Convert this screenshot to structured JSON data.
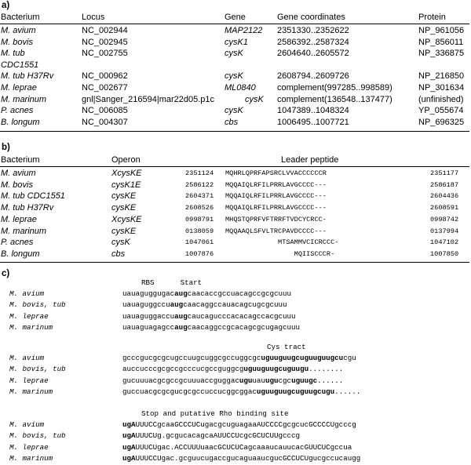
{
  "section_a": {
    "label": "a)",
    "headers": [
      "Bacterium",
      "Locus",
      "Gene",
      "Gene coordinates",
      "Protein"
    ],
    "rows": [
      {
        "bacterium": "M. avium",
        "locus": "NC_002944",
        "gene": "MAP2122",
        "coords": "2351330..2352622",
        "protein": "NP_961056"
      },
      {
        "bacterium": "M. bovis",
        "locus": "NC_002945",
        "gene": "cysK1",
        "coords": "2586392..2587324",
        "protein": "NP_856011"
      },
      {
        "bacterium": "M. tub",
        "locus": "NC_002755",
        "gene": "cysK",
        "coords": "2604640..2605572",
        "protein": "NP_336875"
      },
      {
        "bacterium": "CDC1551",
        "locus": "",
        "gene": "",
        "coords": "",
        "protein": ""
      },
      {
        "bacterium": "M. tub H37Rv",
        "locus": "NC_000962",
        "gene": "cysK",
        "coords": "2608794..2609726",
        "protein": "NP_216850"
      },
      {
        "bacterium": "M. leprae",
        "locus": "NC_002677",
        "gene": "ML0840",
        "coords": "complement(997285..998589)",
        "protein": "NP_301634"
      },
      {
        "bacterium": "M. marinum",
        "locus": "gnl|Sanger_216594|mar22d05.p1c",
        "gene": "cysK",
        "coords": "complement(136548..137477)",
        "protein": "(unfinished)"
      },
      {
        "bacterium": "P. acnes",
        "locus": "NC_006085",
        "gene": "cysK",
        "coords": "1047389..1048324",
        "protein": "YP_055674"
      },
      {
        "bacterium": "B. longum",
        "locus": "NC_004307",
        "gene": "cbs",
        "coords": "1006495..1007721",
        "protein": "NP_696325"
      }
    ]
  },
  "section_b": {
    "label": "b)",
    "headers": [
      "Bacterium",
      "Operon",
      "Leader peptide"
    ],
    "rows": [
      {
        "bacterium": "M. avium",
        "operon": "XcysKE",
        "start": "2351124",
        "peptide": "MQHRLQPRFAPSRCLVVACCCCCCR",
        "end": "2351177"
      },
      {
        "bacterium": "M. bovis",
        "operon": "cysK1E",
        "start": "2586122",
        "peptide": "MQQAIQLRFILPRRLAVGCCCC---",
        "end": "2586187"
      },
      {
        "bacterium": "M. tub CDC1551",
        "operon": "cysKE",
        "start": "2604371",
        "peptide": "MQQAIQLRFILPRRLAVGCCCC---",
        "end": "2604436"
      },
      {
        "bacterium": "M. tub H37Rv",
        "operon": "cysKE",
        "start": "2608526",
        "peptide": "MQQAIQLRFILPRRLAVGCCCC---",
        "end": "2608591"
      },
      {
        "bacterium": "M. leprae",
        "operon": "XcysKE",
        "start": "0998791",
        "peptide": "MHQSTQPRFVFTRRFTVDCYCRCC-",
        "end": "0998742"
      },
      {
        "bacterium": "M. marinum",
        "operon": "cysKE",
        "start": "0138059",
        "peptide": "MQQAAQLSFVLTRCPAVDCCCC---",
        "end": "0137994"
      },
      {
        "bacterium": "P. acnes",
        "operon": "cysK",
        "start": "1047061",
        "peptide": "             MTSAMMVCICRCCC-",
        "end": "1047102"
      },
      {
        "bacterium": "B. longum",
        "operon": "cbs",
        "start": "1007876",
        "peptide": "                 MQIISCCCR-",
        "end": "1007850"
      }
    ]
  },
  "section_c": {
    "label": "c)",
    "blocks": [
      {
        "header": "RBS      Start",
        "rows": [
          {
            "name": "M. avium",
            "pre": "uauaguggugac",
            "bold": "aug",
            "post": "caacaccgccuacagccgcgcuuu"
          },
          {
            "name": "M. bovis, tub",
            "pre": "uauaguggccu",
            "bold": "aug",
            "post": "caacaggccauacagcugcgcuuu"
          },
          {
            "name": "M. leprae",
            "pre": "uauaguggaccu",
            "bold": "aug",
            "post": "caucagucccacacagccacgcuuu"
          },
          {
            "name": "M. marinum",
            "pre": "uauaguagagcc",
            "bold": "aug",
            "post": "caacaggccgcacagcgcugagcuuu"
          }
        ]
      },
      {
        "header": "Cys tract",
        "rows": [
          {
            "name": "M. avium",
            "pre": "gcccgucgcgcugccuugcuggcgccuggcgc",
            "bold": "uguuguugcuguuguugcu",
            "post": "cgu"
          },
          {
            "name": "M. bovis, tub",
            "pre": "auccucccgcgccgcccucgccguggcg",
            "bold": "uguuguugcuguugu",
            "post": "........"
          },
          {
            "name": "M. leprae",
            "pre": "gucuuuacgcgccgcuuuaccguggac",
            "bold": "ugu",
            "post": "uau",
            "bold2": "ugu",
            "post2": "cgc",
            "bold3": "uguugc",
            "post3": "......"
          },
          {
            "name": "M. marinum",
            "pre": "guccuacgcgcgucgcgccuccucggcggac",
            "bold": "uguuguugcuguugcugu",
            "post": "......"
          }
        ]
      },
      {
        "header": "Stop and putative Rho binding site",
        "rows": [
          {
            "name": "M. avium",
            "bold": "ugA",
            "post": "UUUCCgcaaGCCCUCugacgcuguagaaAUCCCCgcgcucGCCCCUgcccg"
          },
          {
            "name": "M. bovis, tub",
            "bold": "ugA",
            "post": "UUUCUg.gcgucacagcaAUUCCUcgcGCUCUUgcccg"
          },
          {
            "name": "M. leprae",
            "bold": "ugA",
            "post": "UUUCUgac.ACCUUUuaacGCUCUCagcaaaucauucacGUUCUCgccua"
          },
          {
            "name": "M. marinum",
            "bold": "ugA",
            "post": "UUUCCUgac.gcguucugaccgucaguaaucgucGCCUCUgucgccucaugg"
          }
        ]
      }
    ]
  }
}
